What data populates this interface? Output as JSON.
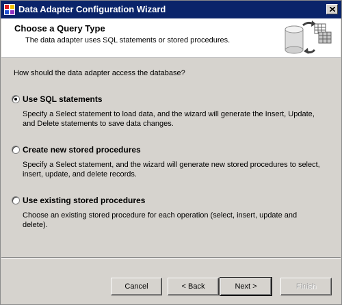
{
  "window": {
    "title": "Data Adapter Configuration Wizard"
  },
  "header": {
    "title": "Choose a Query Type",
    "subtitle": "The data adapter uses SQL statements or stored procedures."
  },
  "question": "How should the data adapter access the database?",
  "options": [
    {
      "label": "Use SQL statements",
      "selected": true,
      "description": "Specify a Select statement to load data, and the wizard will generate the Insert, Update, and Delete statements to save data changes."
    },
    {
      "label": "Create new stored procedures",
      "selected": false,
      "description": "Specify a Select statement, and the wizard will generate new stored procedures to select, insert, update, and delete records."
    },
    {
      "label": "Use existing stored procedures",
      "selected": false,
      "description": "Choose an existing stored procedure for each operation (select, insert, update and delete)."
    }
  ],
  "buttons": {
    "cancel": "Cancel",
    "back": "< Back",
    "next": "Next >",
    "finish": "Finish"
  },
  "colors": {
    "titlebar": "#0a246a",
    "face": "#d6d3ce"
  }
}
